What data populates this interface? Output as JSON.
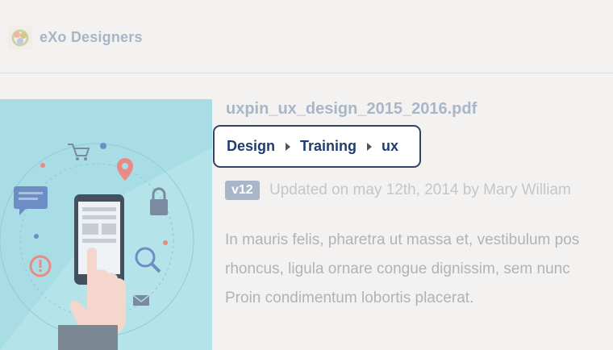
{
  "space": {
    "name": "eXo Designers",
    "avatar_icon": "space-avatar-icon"
  },
  "document": {
    "title": "uxpin_ux_design_2015_2016.pdf",
    "breadcrumb": [
      "Design",
      "Training",
      "ux"
    ],
    "version": "v12",
    "updated": "Updated on may 12th, 2014 by Mary William",
    "description_lines": [
      "In mauris felis, pharetra ut massa et, vestibulum pos",
      "rhoncus, ligula ornare congue dignissim, sem nunc",
      "Proin condimentum lobortis placerat."
    ],
    "thumbnail_icon": "smartphone-illustration"
  },
  "colors": {
    "background": "#f3f2f1",
    "accent": "#1f3e6e",
    "muted_title": "#a9b6c9",
    "thumbnail_bg": "#a8dde6"
  }
}
